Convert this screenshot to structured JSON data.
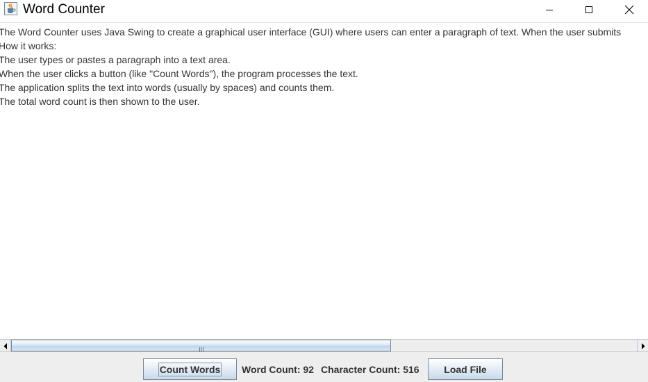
{
  "window": {
    "title": "Word Counter",
    "icon": "java-cup-icon",
    "controls": {
      "minimize": "minimize-icon",
      "maximize": "maximize-icon",
      "close": "close-icon"
    }
  },
  "text_area": {
    "lines": [
      "The Word Counter uses Java Swing to create a graphical user interface (GUI) where users can enter a paragraph of text. When the user submits",
      "How it works:",
      "The user types or pastes a paragraph into a text area.",
      "When the user clicks a button (like \"Count Words\"), the program processes the text.",
      "The application splits the text into words (usually by spaces) and counts them.",
      "The total word count is then shown to the user."
    ]
  },
  "scrollbar": {
    "orientation": "horizontal",
    "position_fraction": 0.0,
    "visible_fraction": 0.6
  },
  "controls": {
    "count_words_label": "Count Words",
    "word_count_label": "Word Count: 92",
    "character_count_label": "Character Count: 516",
    "load_file_label": "Load File"
  },
  "colors": {
    "panel_background": "#eeeeee",
    "button_gradient_top": "#ffffff",
    "button_gradient_bottom": "#c8d9ea",
    "button_border": "#7a8a99",
    "text": "#333333"
  }
}
